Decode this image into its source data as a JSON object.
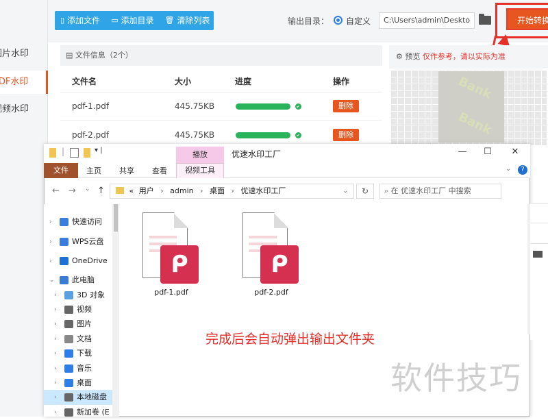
{
  "sidebar": {
    "items": [
      {
        "label": "图片水印",
        "active": false
      },
      {
        "label": "PDF水印",
        "active": true
      },
      {
        "label": "视频水印",
        "active": false
      }
    ]
  },
  "toolbar": {
    "add_file": "添加文件",
    "add_dir": "添加目录",
    "clear_list": "清除列表",
    "output_label": "输出目录：",
    "radio_label": "自定义",
    "output_path": "C:\\Users\\admin\\Deskto",
    "start_button": "开始转换"
  },
  "file_info": {
    "header": "文件信息（2个）",
    "columns": [
      "文件名",
      "大小",
      "进度",
      "操作"
    ],
    "rows": [
      {
        "name": "pdf-1.pdf",
        "size": "445.75KB",
        "progress": 1.0,
        "action": "删除"
      },
      {
        "name": "pdf-2.pdf",
        "size": "445.75KB",
        "progress": 1.0,
        "action": "删除"
      }
    ]
  },
  "preview": {
    "title": "预览",
    "note": "仅作参考，请以实际为准",
    "watermark": "Bank"
  },
  "explorer": {
    "title": "优速水印工厂",
    "context_tab": "播放",
    "ribbon_tabs": [
      "文件",
      "主页",
      "共享",
      "查看",
      "视频工具"
    ],
    "breadcrumb": [
      "«",
      "用户",
      "admin",
      "桌面",
      "优速水印工厂"
    ],
    "search_placeholder": "在 优速水印工厂 中搜索",
    "nav": [
      {
        "label": "快速访问",
        "icon": "star-icon",
        "color": "#3b7ddd"
      },
      {
        "label": "WPS云盘",
        "icon": "cloud-icon",
        "color": "#3b7ddd"
      },
      {
        "label": "OneDrive",
        "icon": "onedrive-icon",
        "color": "#1e6fd6"
      },
      {
        "label": "此电脑",
        "icon": "computer-icon",
        "color": "#3a7bd5"
      },
      {
        "label": "3D 对象",
        "icon": "cube-icon",
        "color": "#5aa0e0"
      },
      {
        "label": "视频",
        "icon": "video-icon",
        "color": "#666666"
      },
      {
        "label": "图片",
        "icon": "picture-icon",
        "color": "#666666"
      },
      {
        "label": "文档",
        "icon": "document-icon",
        "color": "#888888"
      },
      {
        "label": "下载",
        "icon": "download-icon",
        "color": "#2f7ee8"
      },
      {
        "label": "音乐",
        "icon": "music-icon",
        "color": "#2f7ee8"
      },
      {
        "label": "桌面",
        "icon": "desktop-icon",
        "color": "#2f7ee8"
      },
      {
        "label": "本地磁盘",
        "icon": "disk-icon",
        "color": "#666666"
      },
      {
        "label": "新加卷 (E",
        "icon": "disk-icon",
        "color": "#666666"
      }
    ],
    "files": [
      "pdf-1.pdf",
      "pdf-2.pdf"
    ],
    "hint": "完成后会自动弹出输出文件夹"
  },
  "watermark_text": "软件技巧"
}
